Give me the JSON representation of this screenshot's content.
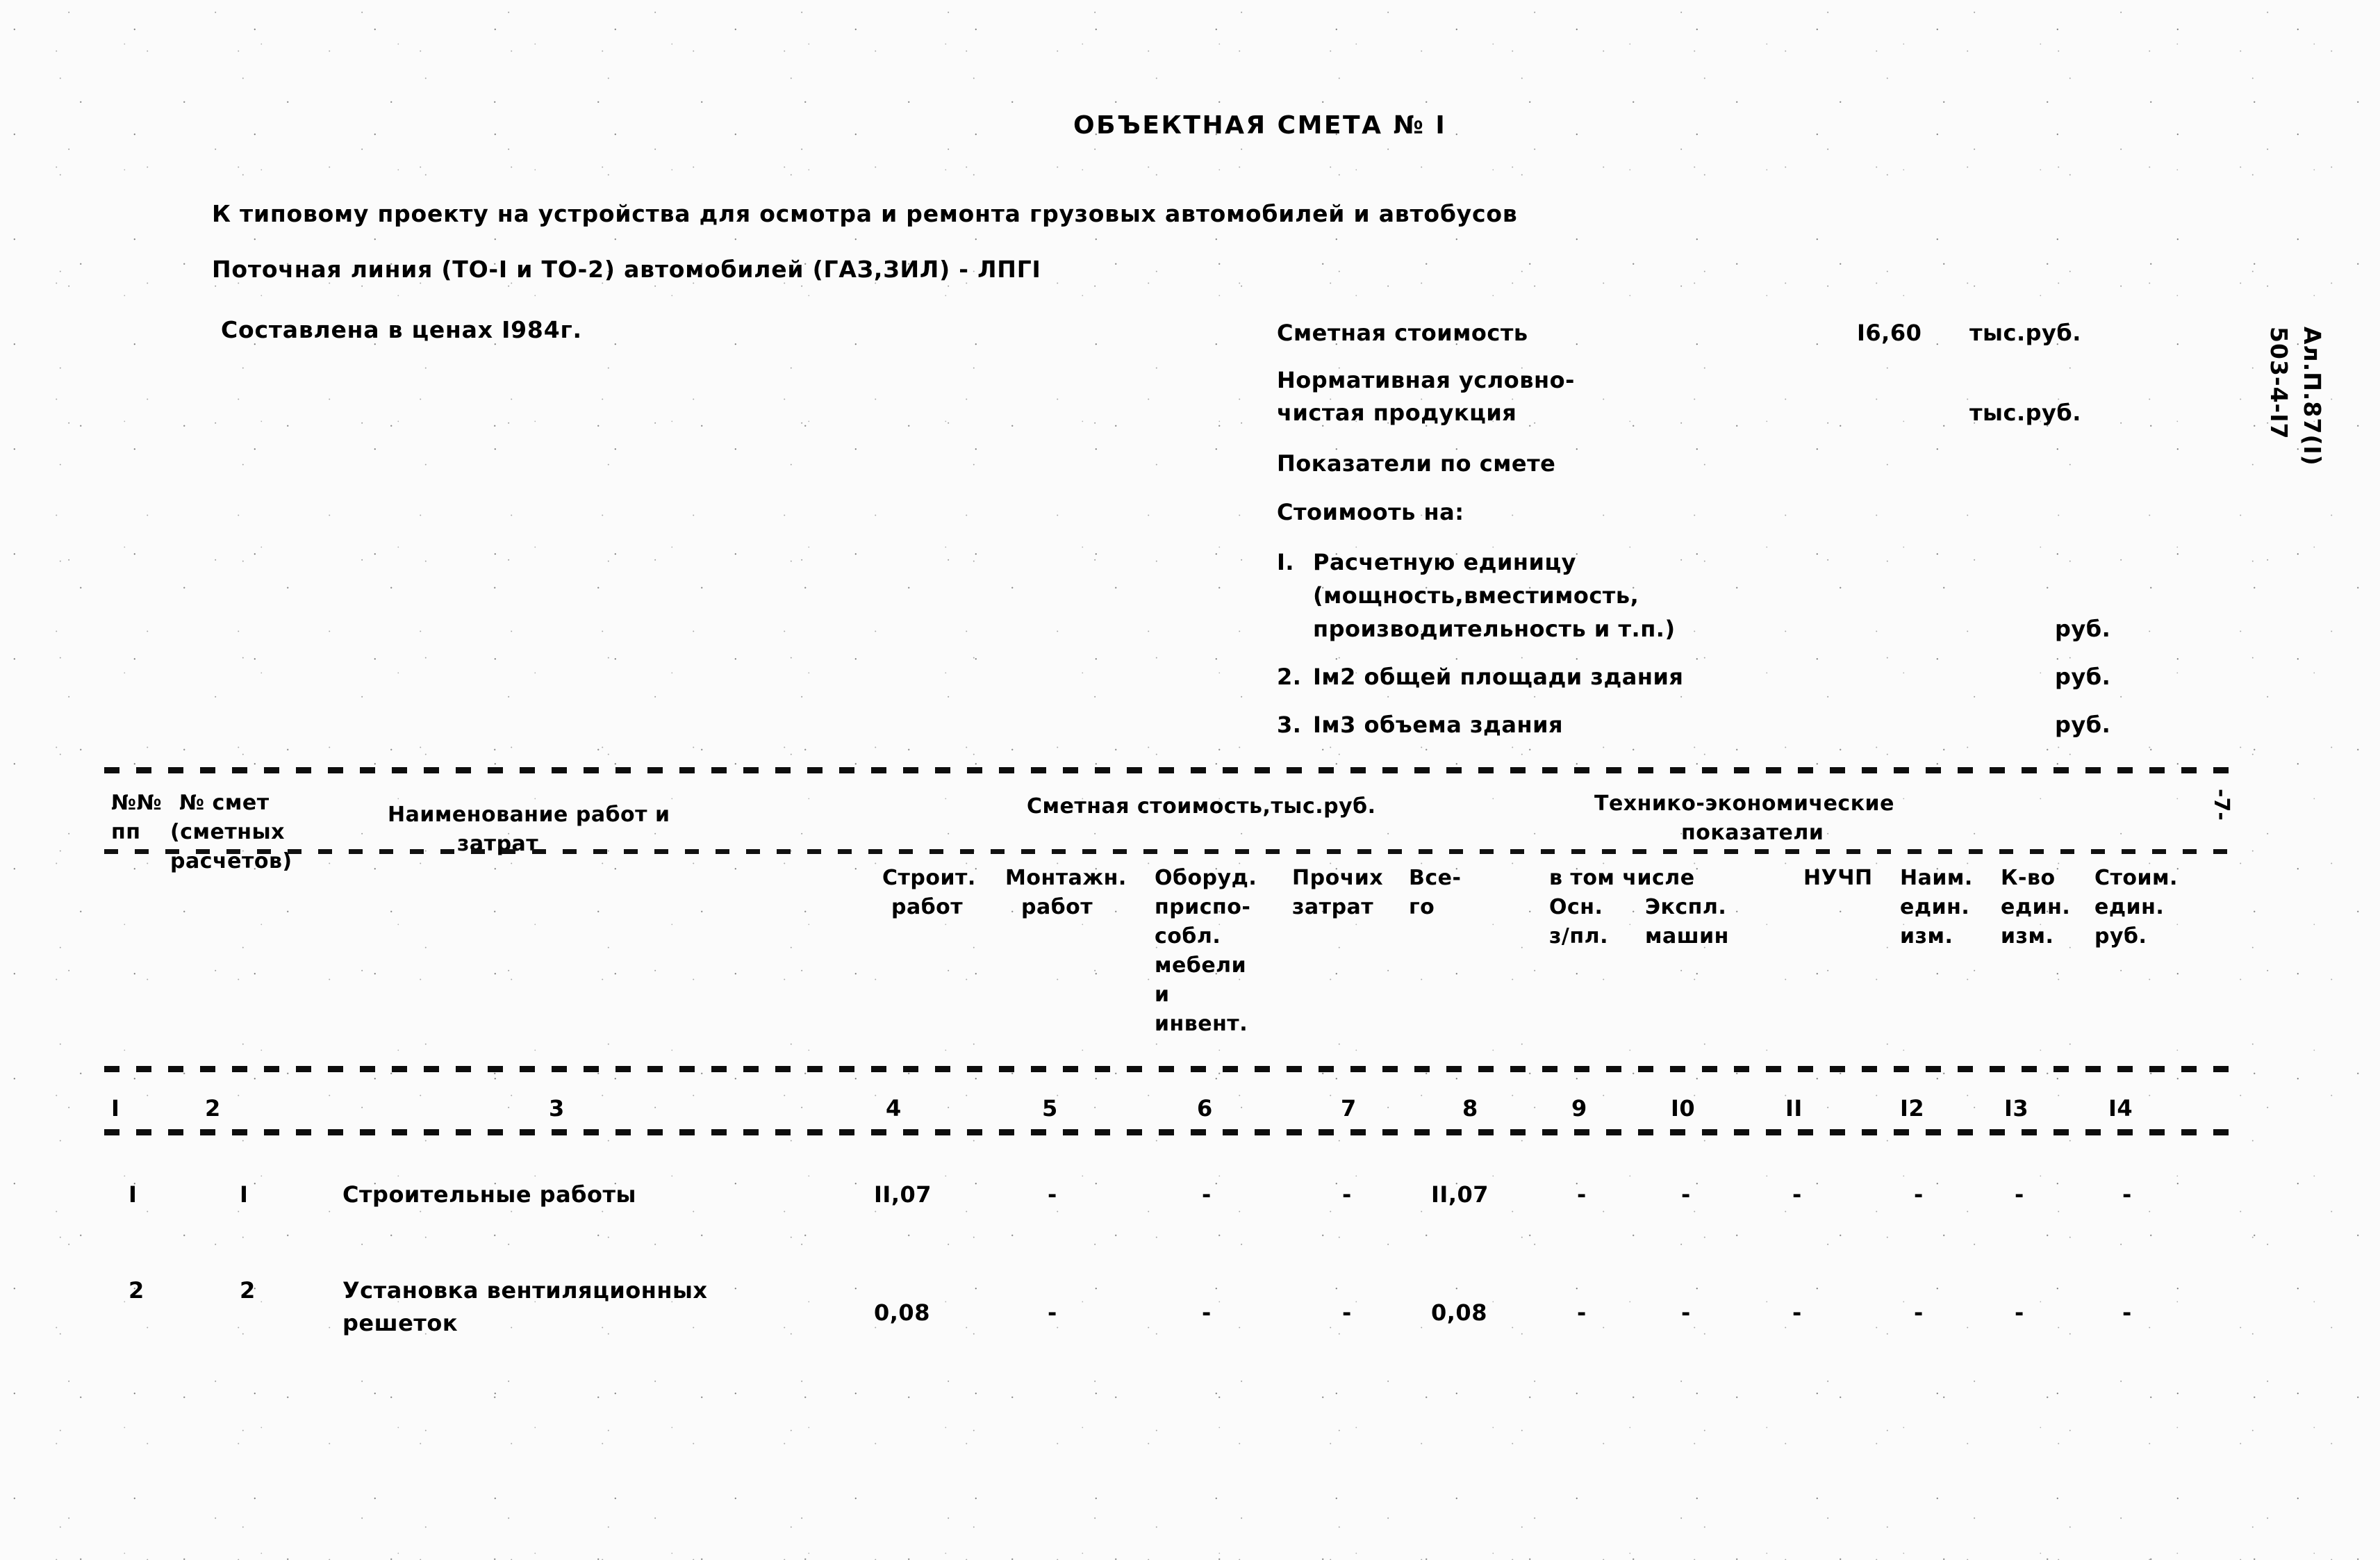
{
  "document": {
    "title": "ОБЪЕКТНАЯ СМЕТА № I",
    "subtitle_line1": "К типовому проекту на устройства для осмотра и ремонта грузовых автомобилей и автобусов",
    "subtitle_line2": "Поточная линия (ТО-I и ТО-2) автомобилей (ГАЗ,ЗИЛ) - ЛПГI",
    "prices_note": "Составлена в ценах I984г."
  },
  "summary": {
    "estimate_cost_label": "Сметная стоимость",
    "estimate_cost_value": "I6,60",
    "estimate_cost_unit": "тыс.руб.",
    "nucp_label_line1": "Нормативная условно-",
    "nucp_label_line2": "чистая продукция",
    "nucp_value": "",
    "nucp_unit": "тыс.руб.",
    "indicators_label": "Показатели по смете",
    "cost_per_label": "Стоимооть на:",
    "items": [
      {
        "num": "I.",
        "text_line1": "Расчетную единицу",
        "text_line2": "(мощность,вместимость,",
        "text_line3": "производительность и т.п.)",
        "value": "",
        "unit": "руб."
      },
      {
        "num": "2.",
        "text_line1": "Iм2 общей площади здания",
        "text_line2": "",
        "text_line3": "",
        "value": "",
        "unit": "руб."
      },
      {
        "num": "3.",
        "text_line1": "Iм3 объема здания",
        "text_line2": "",
        "text_line3": "",
        "value": "",
        "unit": "руб."
      }
    ]
  },
  "table": {
    "group_headers": {
      "cost": "Сметная стоимость,тыс.руб.",
      "tech_line1": "Технико-экономические",
      "tech_line2": "показатели",
      "included_line": "в том числе"
    },
    "headers": {
      "c1_line1": "№№",
      "c1_line2": "пп",
      "c2_line1": "№ смет",
      "c2_line2": "(сметных",
      "c2_line3": "расчетов)",
      "c3_line1": "Наименование работ и",
      "c3_line2": "затрат",
      "c4_line1": "Строит.",
      "c4_line2": "работ",
      "c5_line1": "Монтажн.",
      "c5_line2": "работ",
      "c6_line1": "Оборуд.",
      "c6_line2": "приспо-",
      "c6_line3": "собл.",
      "c6_line4": "мебели",
      "c6_line5": "и",
      "c6_line6": "инвент.",
      "c7_line1": "Прочих",
      "c7_line2": "затрат",
      "c8_line1": "Все-",
      "c8_line2": "го",
      "c9_line1": "Осн.",
      "c9_line2": "з/пл.",
      "c10_line1": "Экспл.",
      "c10_line2": "машин",
      "c11_line1": "НУЧП",
      "c12_line1": "Наим.",
      "c12_line2": "един.",
      "c12_line3": "изм.",
      "c13_line1": "К-во",
      "c13_line2": "един.",
      "c13_line3": "изм.",
      "c14_line1": "Стоим.",
      "c14_line2": "един.",
      "c14_line3": "руб."
    },
    "column_numbers": [
      "I",
      "2",
      "3",
      "4",
      "5",
      "6",
      "7",
      "8",
      "9",
      "I0",
      "II",
      "I2",
      "I3",
      "I4"
    ],
    "rows": [
      {
        "pp": "I",
        "smeta": "I",
        "name_line1": "Строительные работы",
        "name_line2": "",
        "stroit": "II,07",
        "montazh": "-",
        "oborud": "-",
        "prochih": "-",
        "vsego": "II,07",
        "osn_zpl": "-",
        "eksp_mash": "-",
        "nuchp": "-",
        "naim_ed": "-",
        "kvo_ed": "-",
        "stoim_ed": "-"
      },
      {
        "pp": "2",
        "smeta": "2",
        "name_line1": "Установка вентиляционных",
        "name_line2": "решеток",
        "stroit": "0,08",
        "montazh": "-",
        "oborud": "-",
        "prochih": "-",
        "vsego": "0,08",
        "osn_zpl": "-",
        "eksp_mash": "-",
        "nuchp": "-",
        "naim_ed": "-",
        "kvo_ed": "-",
        "stoim_ed": "-"
      }
    ]
  },
  "margin": {
    "stamp_line1": "503-4-I7",
    "stamp_line2": "Ал.П.87(I)",
    "page_mark": "-7-"
  }
}
